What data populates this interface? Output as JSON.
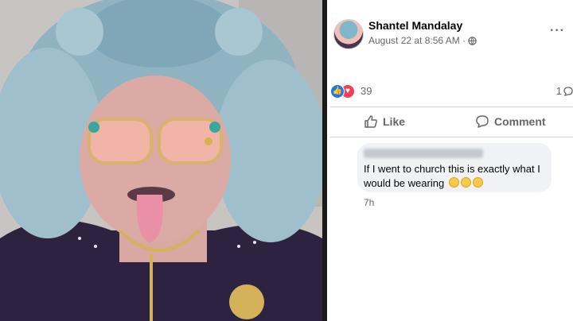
{
  "photo": {
    "description_icon": "selfie-photo"
  },
  "post": {
    "author": "Shantel Mandalay",
    "date": "August 22 at 8:56 AM",
    "privacy_icon": "globe-icon",
    "menu_icon": "more-options-icon",
    "menu_label": "···"
  },
  "reactions": {
    "like_symbol": "👍",
    "love_symbol": "♥",
    "count": "39",
    "comments_count": "1"
  },
  "actions": {
    "like_label": "Like",
    "comment_label": "Comment"
  },
  "comment": {
    "text": "If I went to church this is exactly what I would be wearing",
    "time": "7h"
  },
  "colors": {
    "accent": "#1877f2",
    "love": "#f33e58",
    "secondary_text": "#65676b"
  }
}
